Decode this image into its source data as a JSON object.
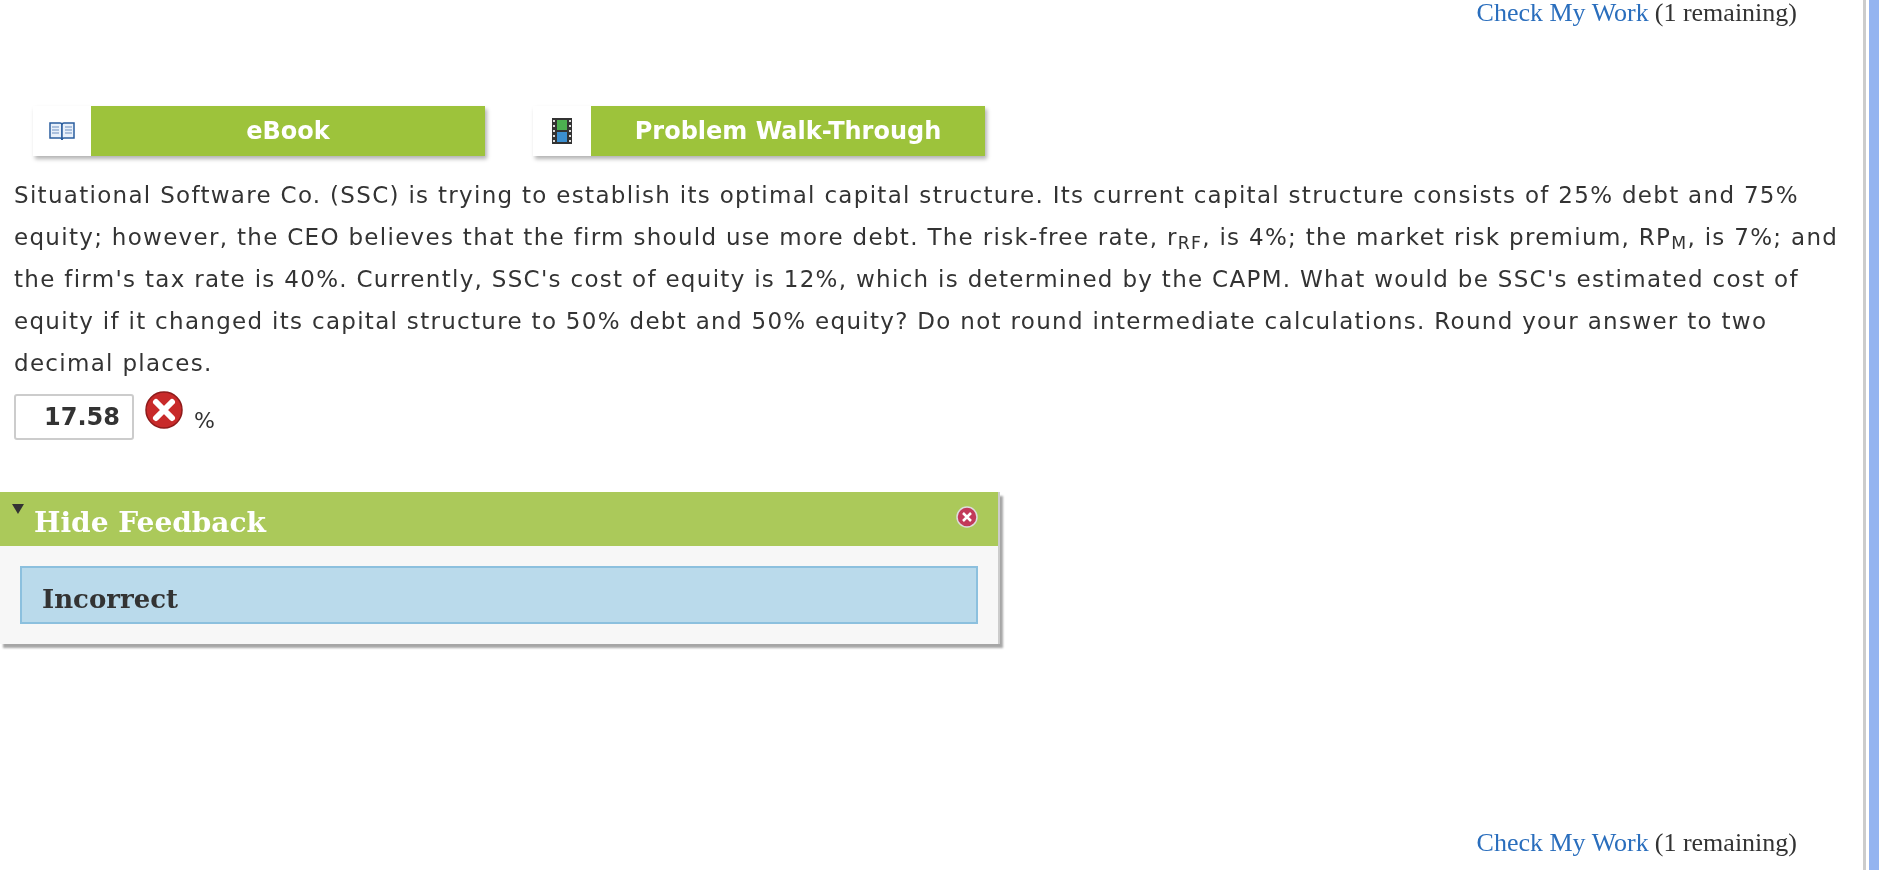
{
  "check_top": {
    "link": "Check My Work",
    "note": "(1 remaining)"
  },
  "resources": [
    {
      "kind": "ebook",
      "label": "eBook"
    },
    {
      "kind": "video",
      "label": "Problem Walk-Through"
    }
  ],
  "question": "Situational Software Co. (SSC) is trying to establish its optimal capital structure. Its current capital structure consists of 25% debt and 75% equity; however, the CEO believes that the firm should use more debt. The risk-free rate, r$_{RF}$, is 4%; the market risk premium, RP$_{M}$, is 7%; and the firm's tax rate is 40%. Currently, SSC's cost of equity is 12%, which is determined by the CAPM. What would be SSC's estimated cost of equity if it changed its capital structure to 50% debt and 50% equity? Do not round intermediate calculations. Round your answer to two decimal places.",
  "answer": {
    "value": "17.58",
    "correct": false,
    "unit": "%"
  },
  "feedback": {
    "title": "Hide Feedback",
    "expanded": true,
    "message": "Incorrect"
  },
  "check_bottom": {
    "link": "Check My Work",
    "note": "(1 remaining)"
  }
}
